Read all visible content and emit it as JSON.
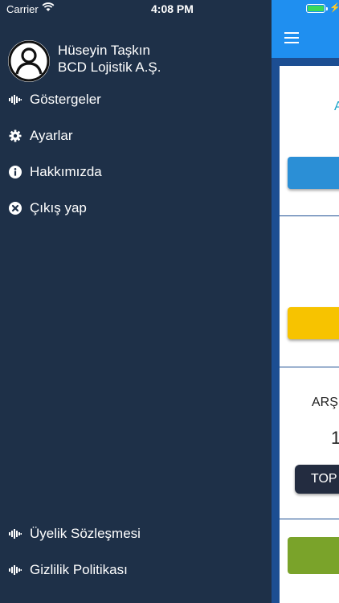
{
  "status_bar": {
    "carrier": "Carrier",
    "time": "4:08 PM"
  },
  "profile": {
    "name": "Hüseyin Taşkın",
    "company": "BCD Lojistik A.Ş."
  },
  "menu": [
    {
      "label": "Göstergeler",
      "icon": "equalizer-icon"
    },
    {
      "label": "Ayarlar",
      "icon": "gear-icon"
    },
    {
      "label": "Hakkımızda",
      "icon": "info-icon"
    },
    {
      "label": "Çıkış yap",
      "icon": "close-circle-icon"
    }
  ],
  "footer_menu": [
    {
      "label": "Üyelik Sözleşmesi",
      "icon": "equalizer-icon"
    },
    {
      "label": "Gizlilik Politikası",
      "icon": "equalizer-icon"
    }
  ],
  "main_peek": {
    "text_a": "A",
    "text_arsiv": "ARŞ",
    "text_count": "1",
    "btn_top": "TOP"
  },
  "colors": {
    "drawer_bg": "#1e3048",
    "navbar": "#1f8ff0",
    "blue_button": "#2b8fd6",
    "yellow_button": "#f7c300",
    "dark_button": "#232c40",
    "green_button": "#7aa32a"
  }
}
